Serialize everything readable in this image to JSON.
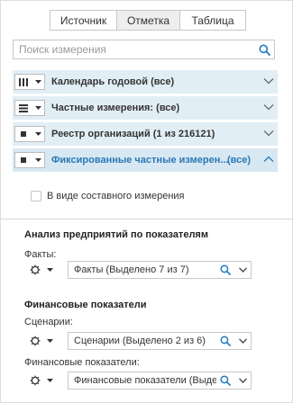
{
  "tabs": [
    {
      "label": "Источник",
      "active": false
    },
    {
      "label": "Отметка",
      "active": true
    },
    {
      "label": "Таблица",
      "active": false
    }
  ],
  "search": {
    "placeholder": "Поиск измерения",
    "value": ""
  },
  "dimensions": [
    {
      "label": "Календарь годовой (все)",
      "icon": "columns-icon",
      "expanded": false
    },
    {
      "label": "Частные измерения: (все)",
      "icon": "rows-icon",
      "expanded": false
    },
    {
      "label": "Реестр организаций (1 из 216121)",
      "icon": "square-icon",
      "expanded": false
    },
    {
      "label": "Фиксированные частные измерен...",
      "extra": "(все)",
      "icon": "square-icon",
      "expanded": true
    }
  ],
  "composite": {
    "label": "В виде составного измерения",
    "checked": false
  },
  "analysis": {
    "title": "Анализ предприятий по показателям",
    "facts_label": "Факты:",
    "facts_value": "Факты (Выделено 7 из 7)"
  },
  "finance": {
    "title": "Финансовые показатели",
    "scenarios_label": "Сценарии:",
    "scenarios_value": "Сценарии (Выделено 2 из 6)",
    "indicators_label": "Финансовые показатели:",
    "indicators_value": "Финансовые показатели (Выделено"
  },
  "colors": {
    "accent": "#2a78b5",
    "row_bg": "#e2eef5",
    "search_icon": "#1f7ac0"
  }
}
